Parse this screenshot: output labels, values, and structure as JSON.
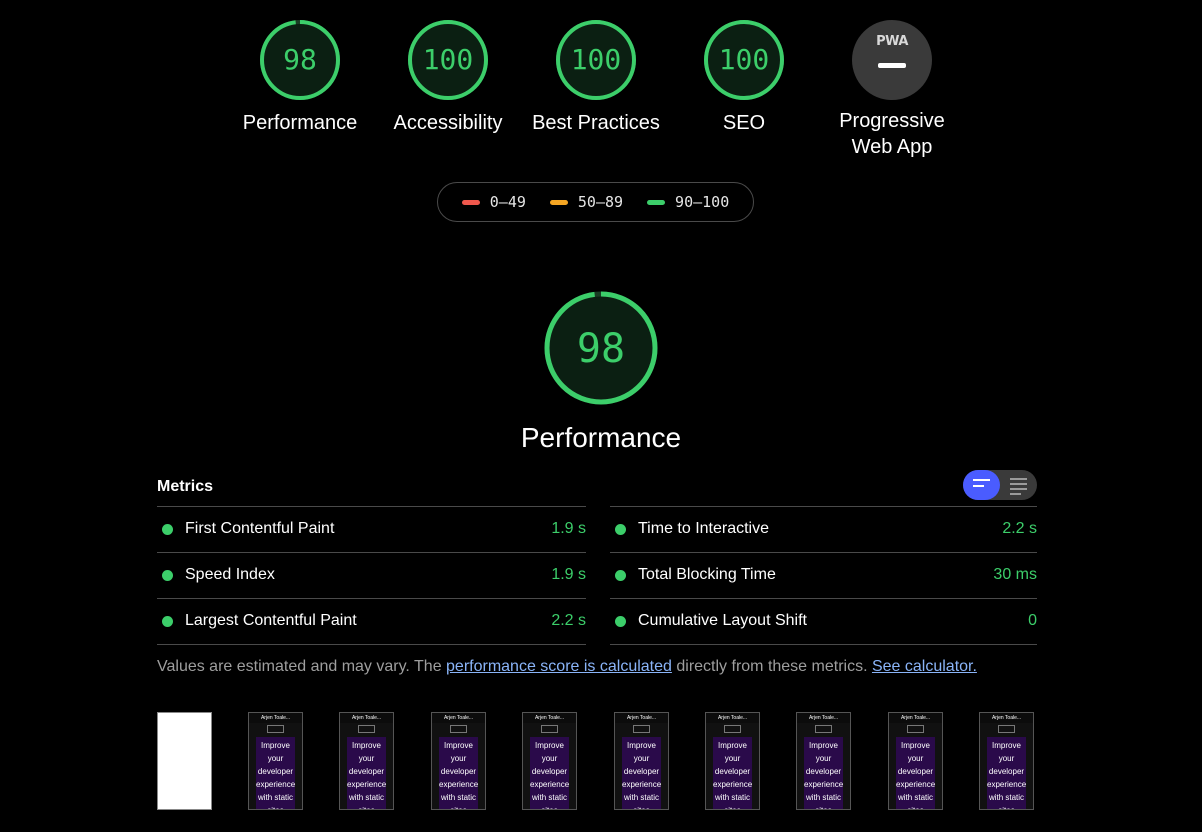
{
  "categories": [
    {
      "score": "98",
      "label": "Performance",
      "value": 98
    },
    {
      "score": "100",
      "label": "Accessibility",
      "value": 100
    },
    {
      "score": "100",
      "label": "Best Practices",
      "value": 100
    },
    {
      "score": "100",
      "label": "SEO",
      "value": 100
    }
  ],
  "pwa": {
    "badge": "PWA",
    "label_line1": "Progressive",
    "label_line2": "Web App"
  },
  "legend": [
    {
      "range": "0–49",
      "color": "#f0584d"
    },
    {
      "range": "50–89",
      "color": "#f5a623"
    },
    {
      "range": "90–100",
      "color": "#3cce6a"
    }
  ],
  "performance": {
    "score": "98",
    "value": 98,
    "title": "Performance"
  },
  "metrics": {
    "title": "Metrics",
    "left": [
      {
        "label": "First Contentful Paint",
        "value": "1.9 s"
      },
      {
        "label": "Speed Index",
        "value": "1.9 s"
      },
      {
        "label": "Largest Contentful Paint",
        "value": "2.2 s"
      }
    ],
    "right": [
      {
        "label": "Time to Interactive",
        "value": "2.2 s"
      },
      {
        "label": "Total Blocking Time",
        "value": "30 ms"
      },
      {
        "label": "Cumulative Layout Shift",
        "value": "0"
      }
    ]
  },
  "note": {
    "text1": "Values are estimated and may vary. The ",
    "link1": "performance score is calculated",
    "text2": " directly from these metrics. ",
    "link2": "See calculator."
  },
  "filmstrip": {
    "site_title": "Arjen Toale...",
    "frame_text": "Improve your developer experience with static sites"
  },
  "colors": {
    "pass": "#3cce6a",
    "accent": "#4a5cff"
  }
}
